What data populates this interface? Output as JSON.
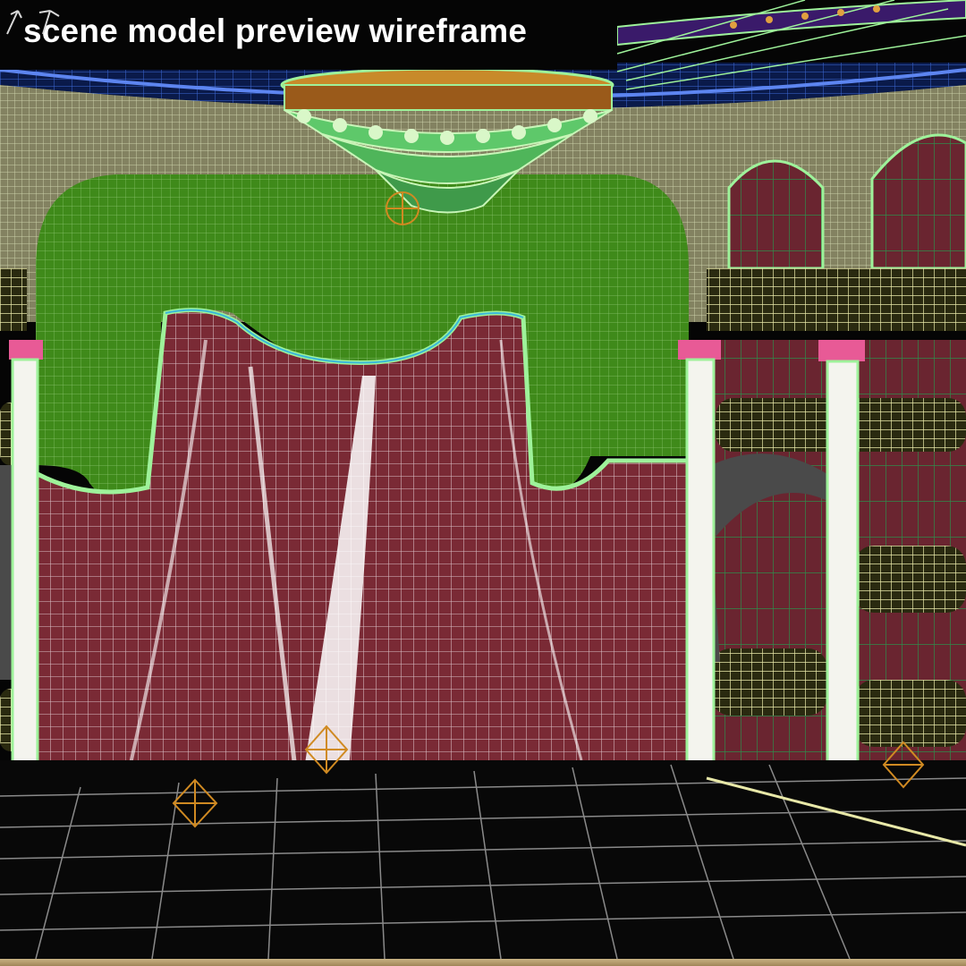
{
  "viewport": {
    "title": "scene model preview wireframe",
    "colors": {
      "background": "#050505",
      "wireframe_green": "#9ef29a",
      "drape_green": "#3f8a1a",
      "curtain_maroon": "#7a2a35",
      "curtain_wire": "#f2e6ea",
      "ceiling_blue": "#1b3fa8",
      "chandelier_gold": "#c88a2a",
      "column_pink": "#e85a96",
      "helper_orange": "#d08a22",
      "floor_grid": "#8a8a8a"
    },
    "icons": [
      "chandelier-icon",
      "helper-point-icon",
      "axis-gizmo-icon"
    ]
  }
}
